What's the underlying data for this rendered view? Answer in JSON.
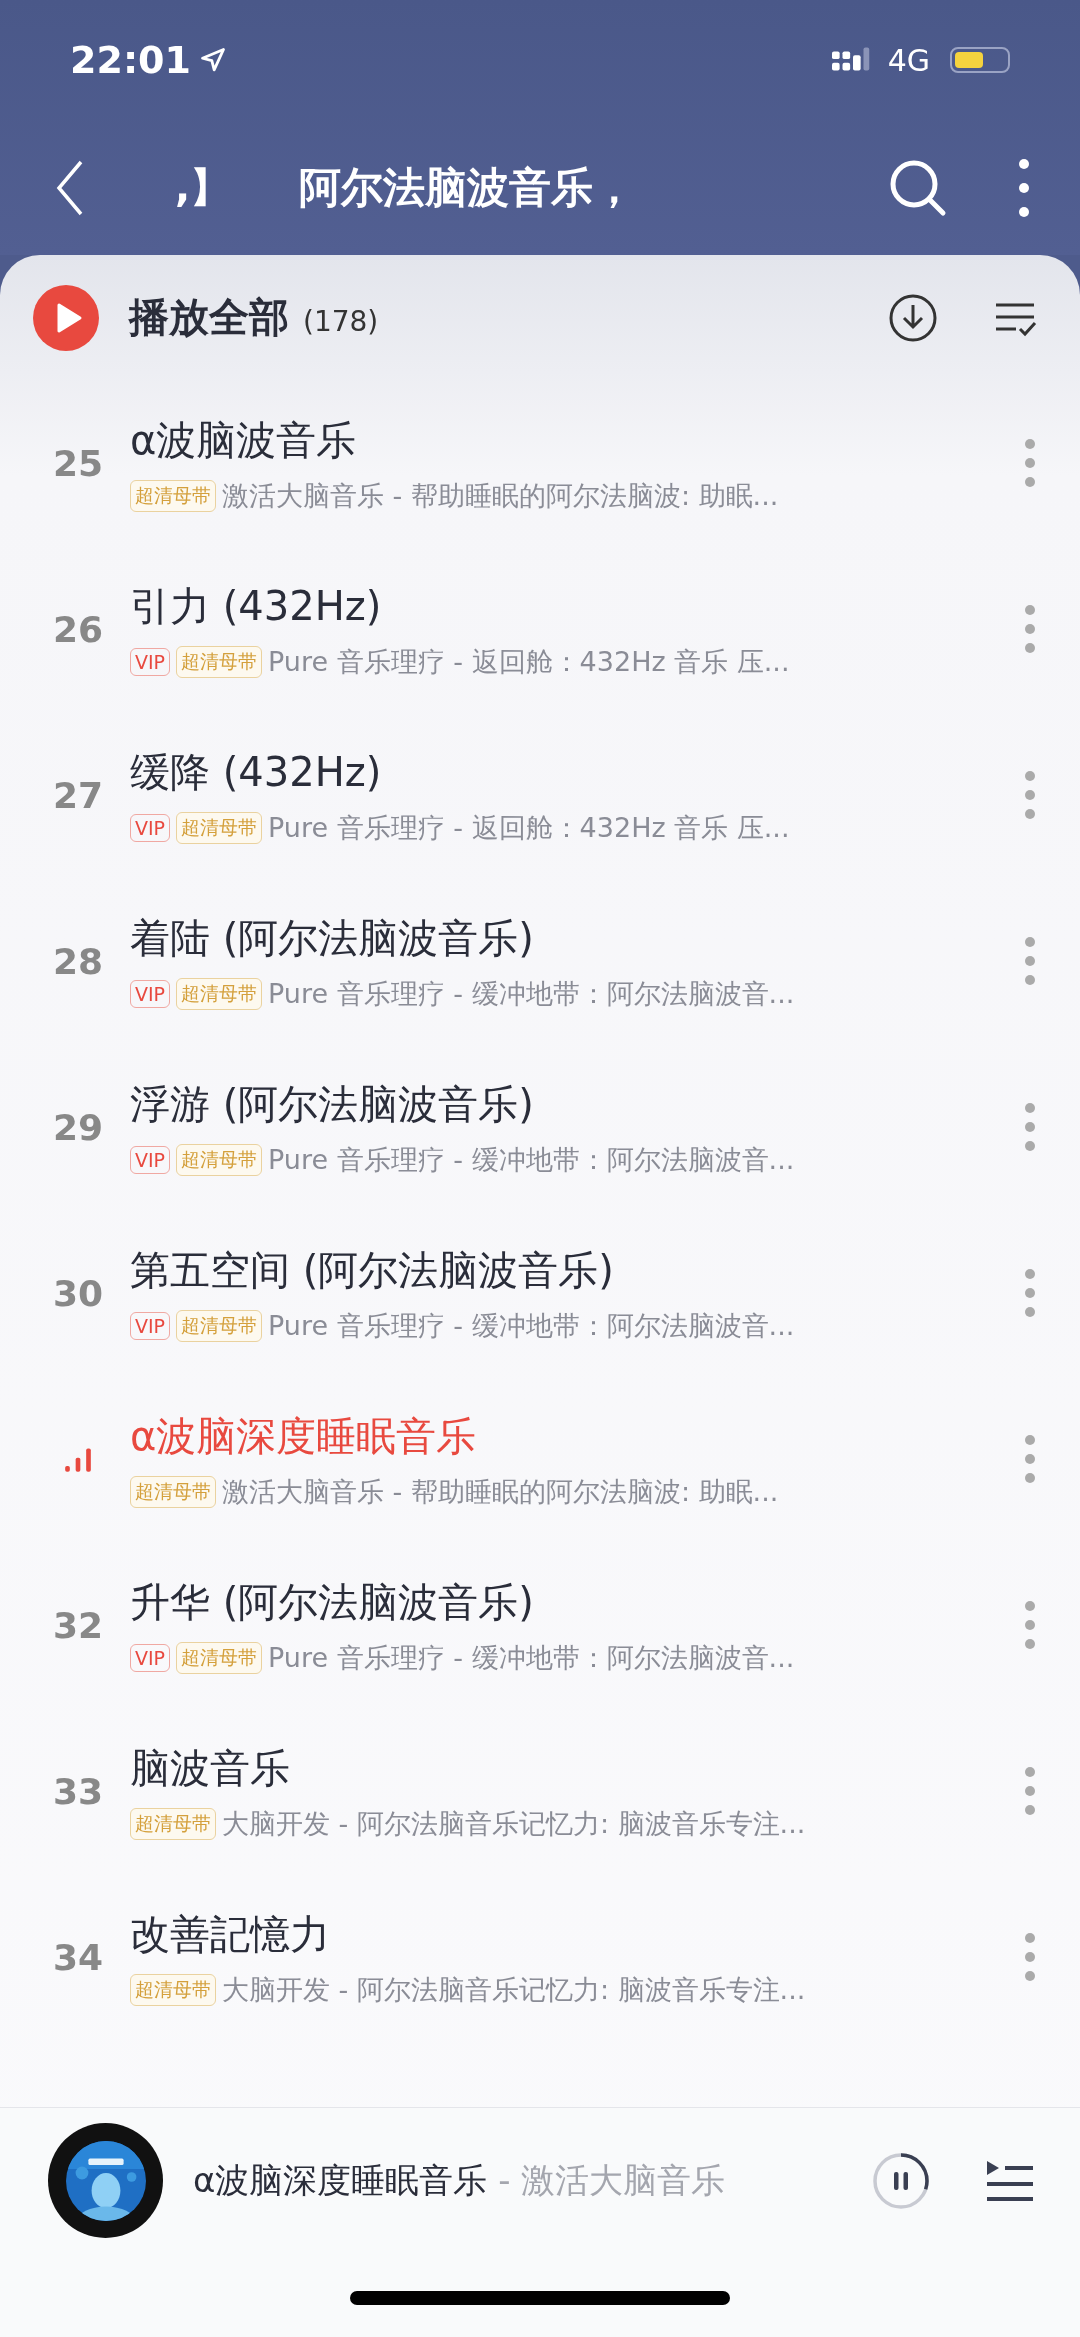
{
  "status_bar": {
    "time": "22:01",
    "network": "4G"
  },
  "nav": {
    "title_tail": ",】",
    "title": "阿尔法脑波音乐，"
  },
  "play_all": {
    "label": "播放全部",
    "count": "(178)"
  },
  "songs": [
    {
      "number": "25",
      "playing": false,
      "title": "α波脑波音乐",
      "badges": [
        {
          "kind": "hq",
          "text": "超清母带"
        }
      ],
      "subtitle": "激活大脑音乐 - 帮助睡眠的阿尔法脑波: 助眠..."
    },
    {
      "number": "26",
      "playing": false,
      "title": "引力 (432Hz)",
      "badges": [
        {
          "kind": "vip",
          "text": "VIP"
        },
        {
          "kind": "hq",
          "text": "超清母带"
        }
      ],
      "subtitle": "Pure 音乐理疗 - 返回舱：432Hz 音乐 压..."
    },
    {
      "number": "27",
      "playing": false,
      "title": "缓降 (432Hz)",
      "badges": [
        {
          "kind": "vip",
          "text": "VIP"
        },
        {
          "kind": "hq",
          "text": "超清母带"
        }
      ],
      "subtitle": "Pure 音乐理疗 - 返回舱：432Hz 音乐 压..."
    },
    {
      "number": "28",
      "playing": false,
      "title": "着陆 (阿尔法脑波音乐)",
      "badges": [
        {
          "kind": "vip",
          "text": "VIP"
        },
        {
          "kind": "hq",
          "text": "超清母带"
        }
      ],
      "subtitle": "Pure 音乐理疗 - 缓冲地带：阿尔法脑波音..."
    },
    {
      "number": "29",
      "playing": false,
      "title": "浮游 (阿尔法脑波音乐)",
      "badges": [
        {
          "kind": "vip",
          "text": "VIP"
        },
        {
          "kind": "hq",
          "text": "超清母带"
        }
      ],
      "subtitle": "Pure 音乐理疗 - 缓冲地带：阿尔法脑波音..."
    },
    {
      "number": "30",
      "playing": false,
      "title": "第五空间 (阿尔法脑波音乐)",
      "badges": [
        {
          "kind": "vip",
          "text": "VIP"
        },
        {
          "kind": "hq",
          "text": "超清母带"
        }
      ],
      "subtitle": "Pure 音乐理疗 - 缓冲地带：阿尔法脑波音..."
    },
    {
      "playing": true,
      "title": "α波脑深度睡眠音乐",
      "badges": [
        {
          "kind": "hq",
          "text": "超清母带"
        }
      ],
      "subtitle": "激活大脑音乐 - 帮助睡眠的阿尔法脑波: 助眠..."
    },
    {
      "number": "32",
      "playing": false,
      "title": "升华 (阿尔法脑波音乐)",
      "badges": [
        {
          "kind": "vip",
          "text": "VIP"
        },
        {
          "kind": "hq",
          "text": "超清母带"
        }
      ],
      "subtitle": "Pure 音乐理疗 - 缓冲地带：阿尔法脑波音..."
    },
    {
      "number": "33",
      "playing": false,
      "title": "脑波音乐",
      "badges": [
        {
          "kind": "hq",
          "text": "超清母带"
        }
      ],
      "subtitle": "大脑开发 - 阿尔法脑音乐记忆力: 脑波音乐专注..."
    },
    {
      "number": "34",
      "playing": false,
      "title": "改善記憶力",
      "badges": [
        {
          "kind": "hq",
          "text": "超清母带"
        }
      ],
      "subtitle": "大脑开发 - 阿尔法脑音乐记忆力: 脑波音乐专注..."
    }
  ],
  "player": {
    "title": "α波脑深度睡眠音乐",
    "artist": " - 激活大脑音乐",
    "level": 0.3
  }
}
